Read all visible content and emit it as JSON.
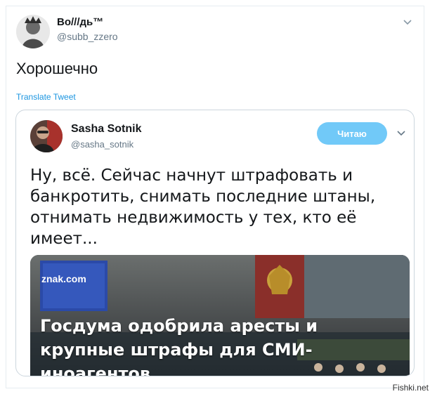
{
  "tweet": {
    "author": {
      "display_name": "Во///дь™",
      "handle": "@subb_zzero"
    },
    "text": "Хорошечно",
    "translate_label": "Translate Tweet"
  },
  "quoted_tweet": {
    "author": {
      "display_name": "Sasha Sotnik",
      "handle": "@sasha_sotnik"
    },
    "follow_button_label": "Читаю",
    "text": "Ну, всё. Сейчас начнут штрафовать и банкротить, снимать последние штаны, отнимать недвижимость у тех, кто её имеет...",
    "media": {
      "brand": "znak.com",
      "headline": "Госдума одобрила аресты и крупные штрафы для СМИ-иноагентов"
    }
  },
  "watermark": "Fishki.net",
  "icons": {
    "tweet_caret": "chevron-down-icon",
    "quote_caret": "chevron-down-icon"
  },
  "colors": {
    "link": "#1b95e0",
    "follow_button": "#71c9f8",
    "secondary_text": "#657786",
    "border": "#e6ecf0"
  }
}
